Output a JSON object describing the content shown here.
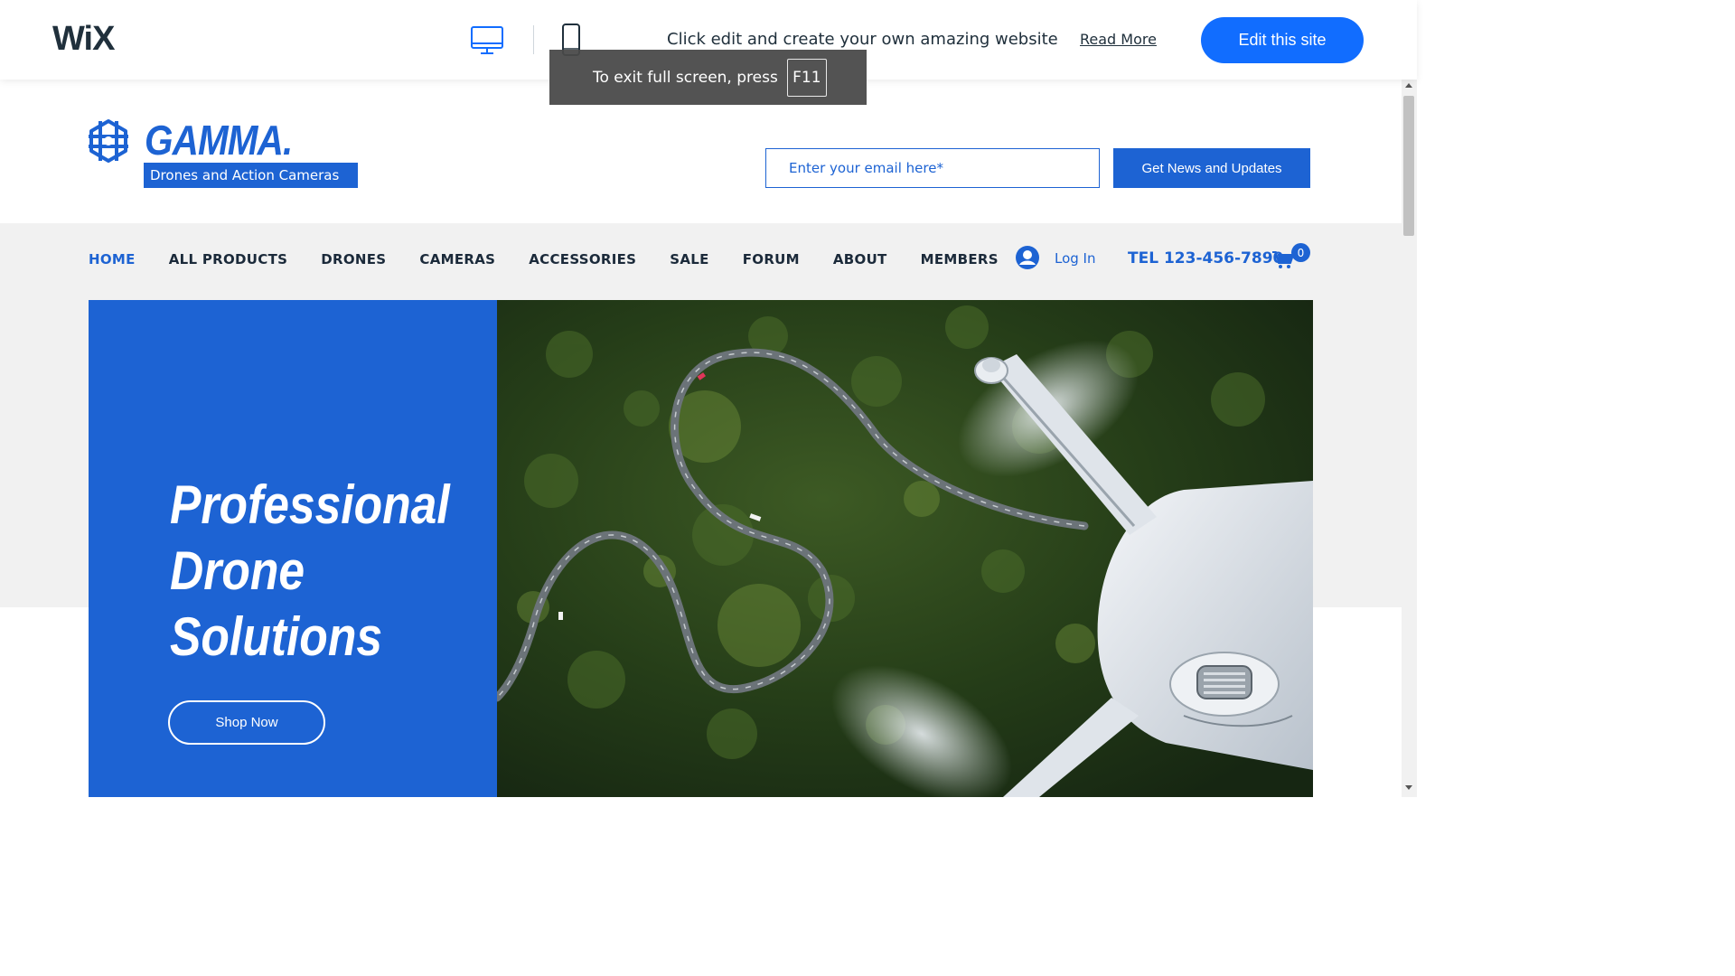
{
  "wix_bar": {
    "logo": "WiX",
    "message": "Click edit and create your own amazing website",
    "read_more": "Read More",
    "edit_button": "Edit this site",
    "device_icons": [
      "desktop-icon",
      "mobile-icon"
    ]
  },
  "fullscreen_toast": {
    "text": "To exit full screen, press",
    "key": "F11"
  },
  "site": {
    "brand": "GAMMA.",
    "tagline": "Drones and Action Cameras",
    "email_placeholder": "Enter your email here*",
    "subscribe_button": "Get News and Updates"
  },
  "nav": {
    "items": [
      {
        "label": "HOME",
        "active": true
      },
      {
        "label": "ALL PRODUCTS"
      },
      {
        "label": "DRONES"
      },
      {
        "label": "CAMERAS"
      },
      {
        "label": "ACCESSORIES"
      },
      {
        "label": "SALE"
      },
      {
        "label": "FORUM"
      },
      {
        "label": "ABOUT"
      },
      {
        "label": "MEMBERS"
      }
    ],
    "login": "Log In",
    "phone": "TEL 123-456-7890",
    "cart_count": "0"
  },
  "hero": {
    "title_lines": [
      "Professional",
      "Drone",
      "Solutions"
    ],
    "cta": "Shop Now"
  },
  "colors": {
    "brand_blue": "#1d63d3",
    "wix_blue": "#116dff",
    "grey_band": "#f1f1f1"
  }
}
